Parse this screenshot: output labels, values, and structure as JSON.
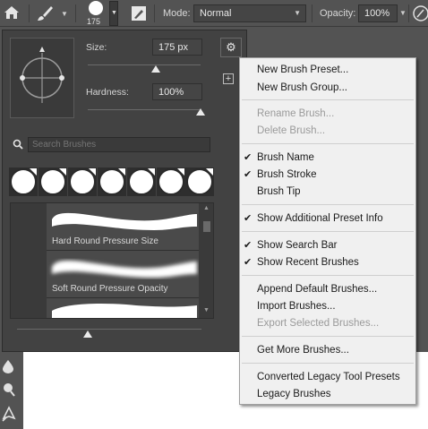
{
  "optionsbar": {
    "brush_size": "175",
    "mode_label": "Mode:",
    "mode_value": "Normal",
    "opacity_label": "Opacity:",
    "opacity_value": "100%"
  },
  "panel": {
    "size_label": "Size:",
    "size_value": "175 px",
    "size_fraction": 0.6,
    "hardness_label": "Hardness:",
    "hardness_value": "100%",
    "hardness_fraction": 1.0,
    "search_placeholder": "Search Brushes",
    "presets": [
      {
        "name": "Hard Round Pressure Size"
      },
      {
        "name": "Soft Round Pressure Opacity"
      }
    ]
  },
  "menu": {
    "items": [
      {
        "label": "New Brush Preset...",
        "enabled": true,
        "checked": false
      },
      {
        "label": "New Brush Group...",
        "enabled": true,
        "checked": false
      },
      {
        "label": "Rename Brush...",
        "enabled": false,
        "checked": false
      },
      {
        "label": "Delete Brush...",
        "enabled": false,
        "checked": false
      },
      {
        "label": "Brush Name",
        "enabled": true,
        "checked": true
      },
      {
        "label": "Brush Stroke",
        "enabled": true,
        "checked": true
      },
      {
        "label": "Brush Tip",
        "enabled": true,
        "checked": false
      },
      {
        "label": "Show Additional Preset Info",
        "enabled": true,
        "checked": true
      },
      {
        "label": "Show Search Bar",
        "enabled": true,
        "checked": true
      },
      {
        "label": "Show Recent Brushes",
        "enabled": true,
        "checked": true
      },
      {
        "label": "Append Default Brushes...",
        "enabled": true,
        "checked": false
      },
      {
        "label": "Import Brushes...",
        "enabled": true,
        "checked": false
      },
      {
        "label": "Export Selected Brushes...",
        "enabled": false,
        "checked": false
      },
      {
        "label": "Get More Brushes...",
        "enabled": true,
        "checked": false
      },
      {
        "label": "Converted Legacy Tool Presets",
        "enabled": true,
        "checked": false
      },
      {
        "label": "Legacy Brushes",
        "enabled": true,
        "checked": false
      }
    ]
  }
}
